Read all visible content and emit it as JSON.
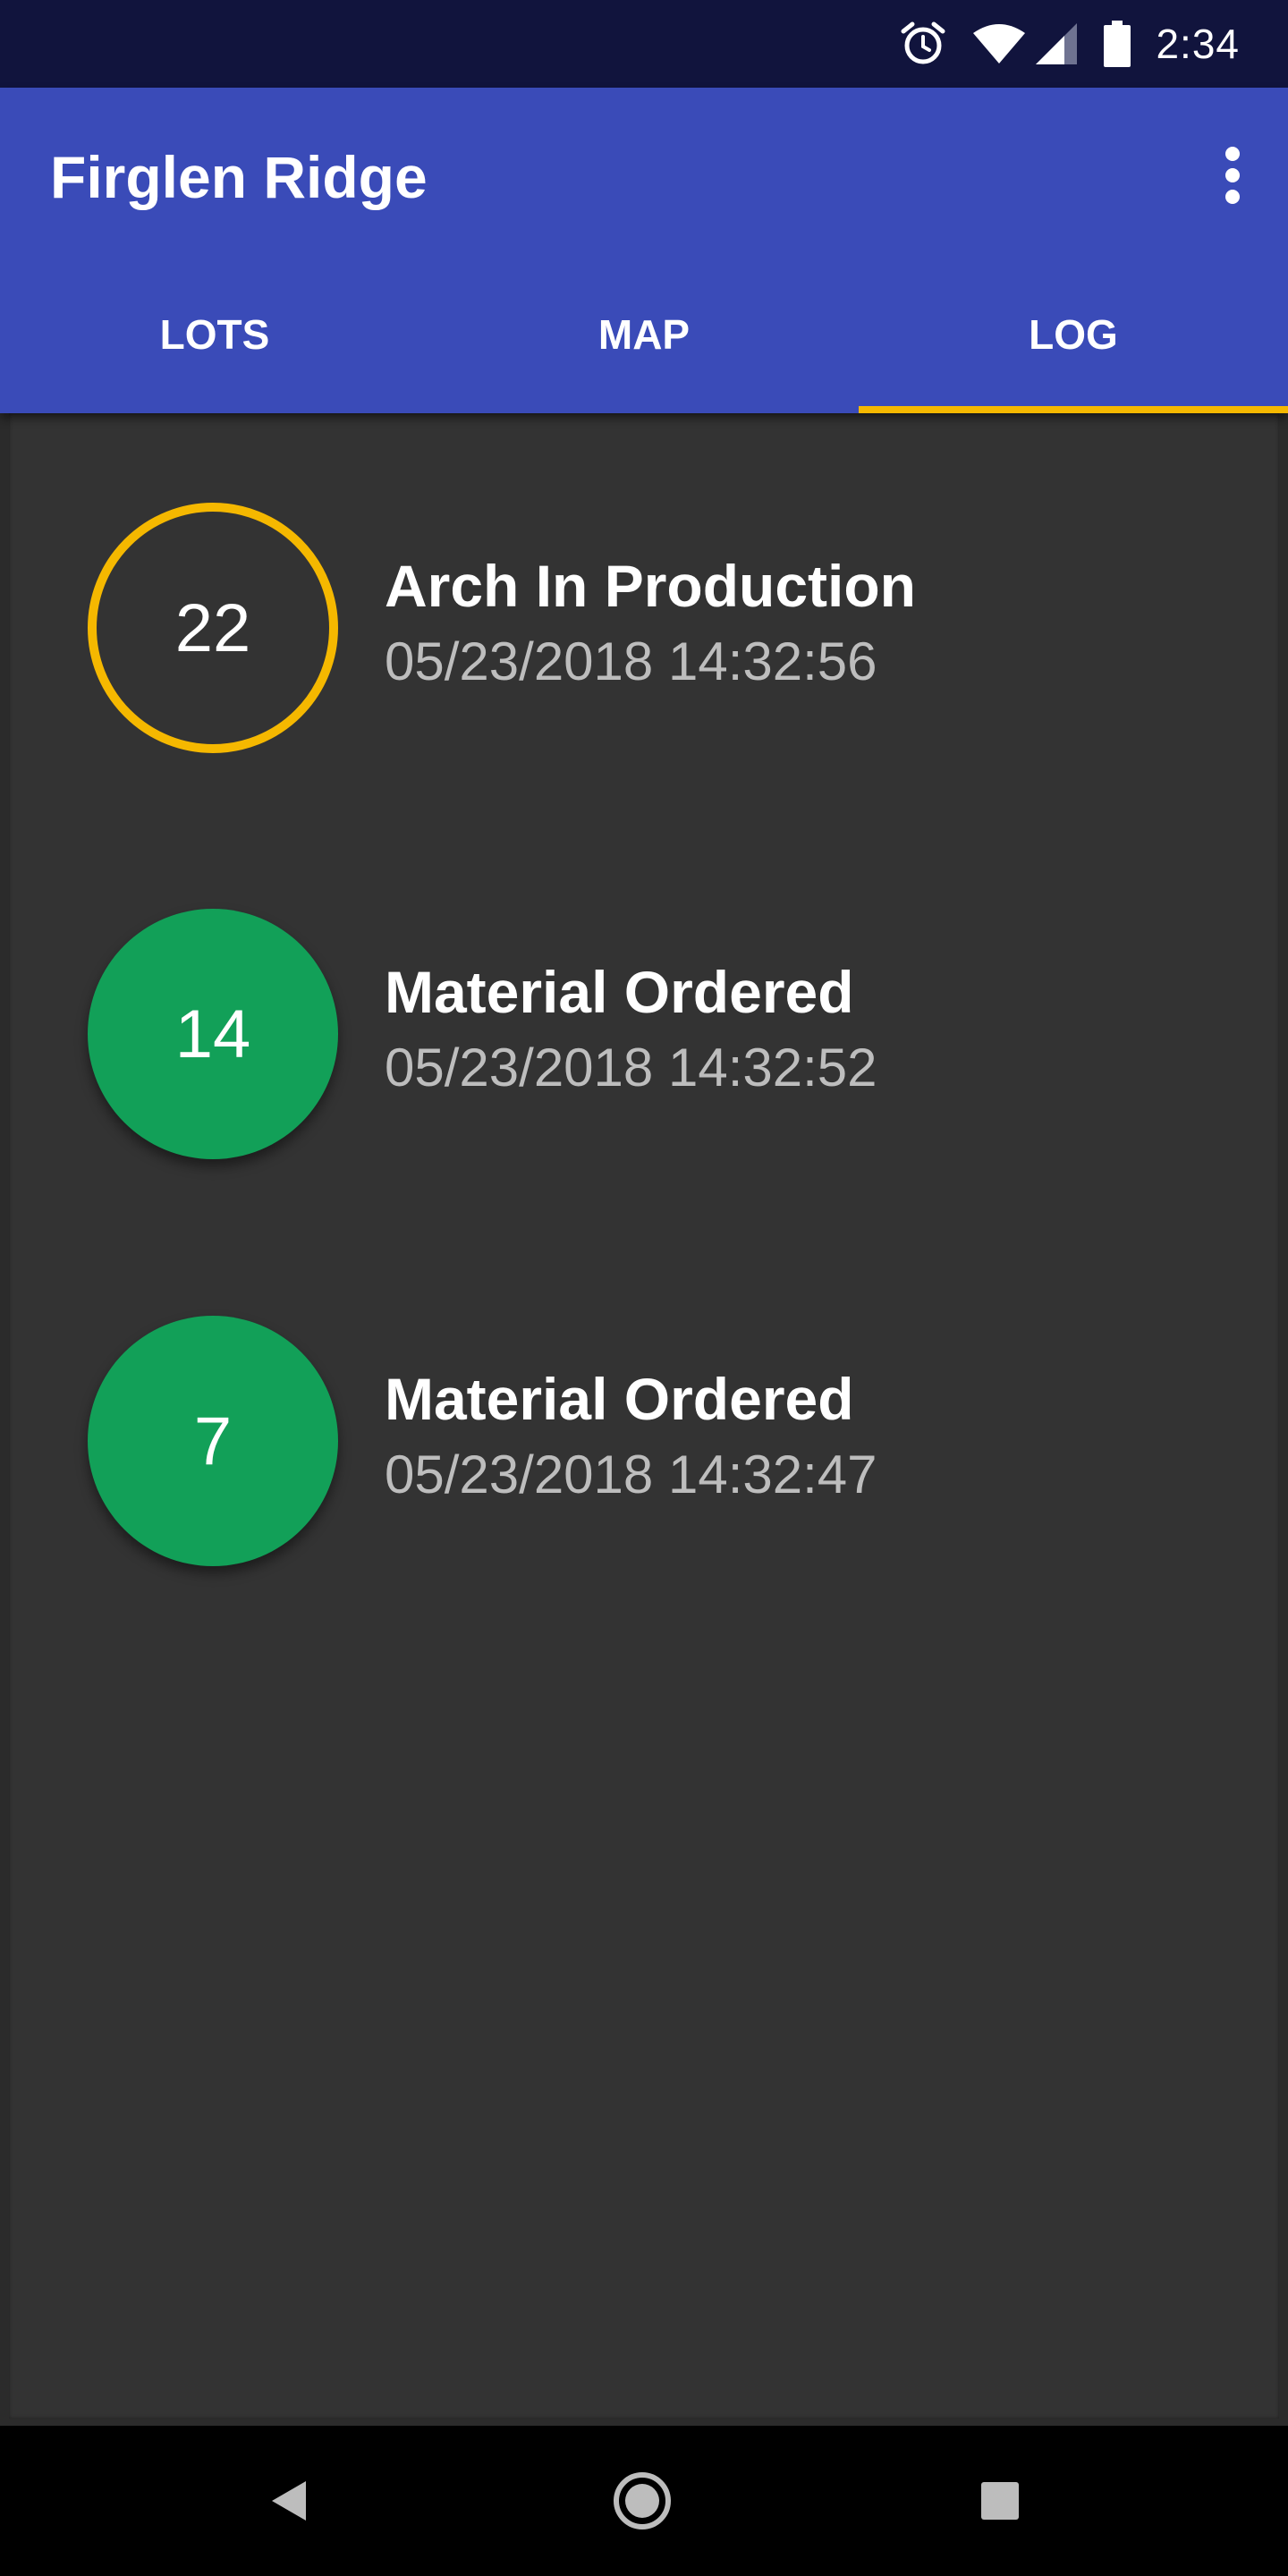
{
  "status_bar": {
    "time": "2:34",
    "icons": [
      "alarm-icon",
      "wifi-icon",
      "cell-signal-icon",
      "battery-icon"
    ]
  },
  "app_bar": {
    "title": "Firglen Ridge",
    "menu_icon": "more-vert-icon"
  },
  "tabs": [
    {
      "label": "LOTS",
      "active": false
    },
    {
      "label": "MAP",
      "active": false
    },
    {
      "label": "LOG",
      "active": true
    }
  ],
  "log": {
    "items": [
      {
        "number": "22",
        "title": "Arch In Production",
        "timestamp": "05/23/2018 14:32:56",
        "badge_style": "ring",
        "badge_color": "#f5b800"
      },
      {
        "number": "14",
        "title": "Material Ordered",
        "timestamp": "05/23/2018 14:32:52",
        "badge_style": "filled",
        "badge_color": "#12a058"
      },
      {
        "number": "7",
        "title": "Material Ordered",
        "timestamp": "05/23/2018 14:32:47",
        "badge_style": "filled",
        "badge_color": "#12a058"
      }
    ]
  },
  "nav_bar": {
    "buttons": [
      "back-icon",
      "home-icon",
      "recents-icon"
    ]
  },
  "colors": {
    "status_bar": "#11143d",
    "app_bar": "#3a4bb8",
    "tab_indicator": "#f5b800",
    "background": "#333333",
    "secondary_text": "#bdbdbd"
  }
}
